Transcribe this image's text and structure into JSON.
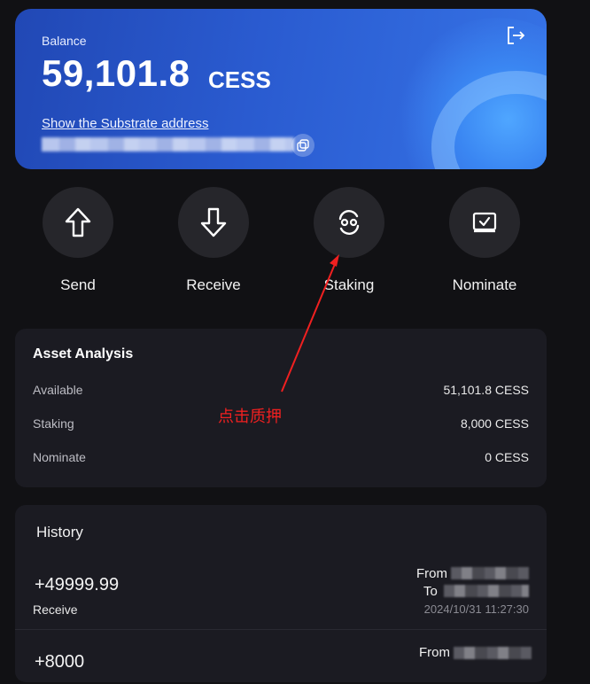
{
  "balance": {
    "label": "Balance",
    "amount": "59,101.8",
    "unit": "CESS",
    "show_address_link": "Show the Substrate address"
  },
  "actions": [
    {
      "label": "Send",
      "icon": "arrow-up-icon"
    },
    {
      "label": "Receive",
      "icon": "arrow-down-icon"
    },
    {
      "label": "Staking",
      "icon": "staking-icon"
    },
    {
      "label": "Nominate",
      "icon": "nominate-icon"
    }
  ],
  "asset_analysis": {
    "title": "Asset Analysis",
    "rows": [
      {
        "label": "Available",
        "value": "51,101.8 CESS"
      },
      {
        "label": "Staking",
        "value": "8,000 CESS"
      },
      {
        "label": "Nominate",
        "value": "0 CESS"
      }
    ]
  },
  "history": {
    "title": "History",
    "items": [
      {
        "amount": "+49999.99",
        "type": "Receive",
        "from_label": "From",
        "to_label": "To",
        "time": "2024/10/31 11:27:30"
      },
      {
        "amount": "+8000",
        "from_label": "From"
      }
    ]
  },
  "annotation": {
    "text": "点击质押",
    "color": "#f02020"
  },
  "colors": {
    "background": "#111114",
    "card_gradient_start": "#2148b5",
    "card_gradient_end": "#3673e6",
    "panel": "#1b1b22",
    "action_circle": "#26262b"
  }
}
